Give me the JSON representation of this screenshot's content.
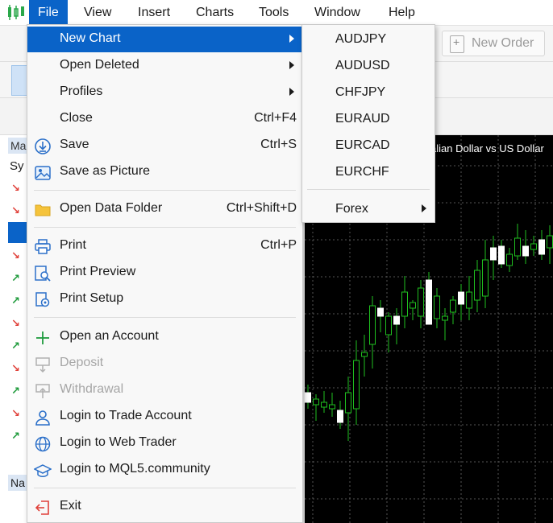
{
  "menubar": {
    "items": [
      {
        "label": "File"
      },
      {
        "label": "View"
      },
      {
        "label": "Insert"
      },
      {
        "label": "Charts"
      },
      {
        "label": "Tools"
      },
      {
        "label": "Window"
      },
      {
        "label": "Help"
      }
    ]
  },
  "toolbar": {
    "new_order_label": "New Order"
  },
  "left_panel": {
    "header": "Ma",
    "sub": "Sy",
    "bottom_header": "Na"
  },
  "chart": {
    "title": "alian Dollar vs US Dollar"
  },
  "file_menu": {
    "items": [
      {
        "label": "New Chart",
        "shortcut": "",
        "submenu": true,
        "icon": "none",
        "highlighted": true
      },
      {
        "label": "Open Deleted",
        "shortcut": "",
        "submenu": true,
        "icon": "none"
      },
      {
        "label": "Profiles",
        "shortcut": "",
        "submenu": true,
        "icon": "none"
      },
      {
        "label": "Close",
        "shortcut": "Ctrl+F4",
        "icon": "none"
      },
      {
        "label": "Save",
        "shortcut": "Ctrl+S",
        "icon": "save-icon"
      },
      {
        "label": "Save as Picture",
        "shortcut": "",
        "icon": "picture-icon"
      },
      {
        "label": "Open Data Folder",
        "shortcut": "Ctrl+Shift+D",
        "icon": "folder-icon"
      },
      {
        "label": "Print",
        "shortcut": "Ctrl+P",
        "icon": "printer-icon"
      },
      {
        "label": "Print Preview",
        "shortcut": "",
        "icon": "print-preview-icon"
      },
      {
        "label": "Print Setup",
        "shortcut": "",
        "icon": "print-setup-icon"
      },
      {
        "label": "Open an Account",
        "shortcut": "",
        "icon": "plus-icon"
      },
      {
        "label": "Deposit",
        "shortcut": "",
        "icon": "deposit-icon",
        "disabled": true
      },
      {
        "label": "Withdrawal",
        "shortcut": "",
        "icon": "withdrawal-icon",
        "disabled": true
      },
      {
        "label": "Login to Trade Account",
        "shortcut": "",
        "icon": "user-icon"
      },
      {
        "label": "Login to Web Trader",
        "shortcut": "",
        "icon": "globe-icon"
      },
      {
        "label": "Login to MQL5.community",
        "shortcut": "",
        "icon": "graduation-cap-icon"
      },
      {
        "label": "Exit",
        "shortcut": "",
        "icon": "exit-icon"
      }
    ]
  },
  "new_chart_submenu": {
    "items": [
      {
        "label": "AUDJPY"
      },
      {
        "label": "AUDUSD"
      },
      {
        "label": "CHFJPY"
      },
      {
        "label": "EURAUD"
      },
      {
        "label": "EURCAD"
      },
      {
        "label": "EURCHF"
      },
      {
        "label": "Forex",
        "submenu": true
      }
    ]
  },
  "colors": {
    "accent": "#0a63c8",
    "chart_bg": "#000000",
    "candle_up": "#ffffff",
    "candle_wick": "#1fbf1f"
  }
}
